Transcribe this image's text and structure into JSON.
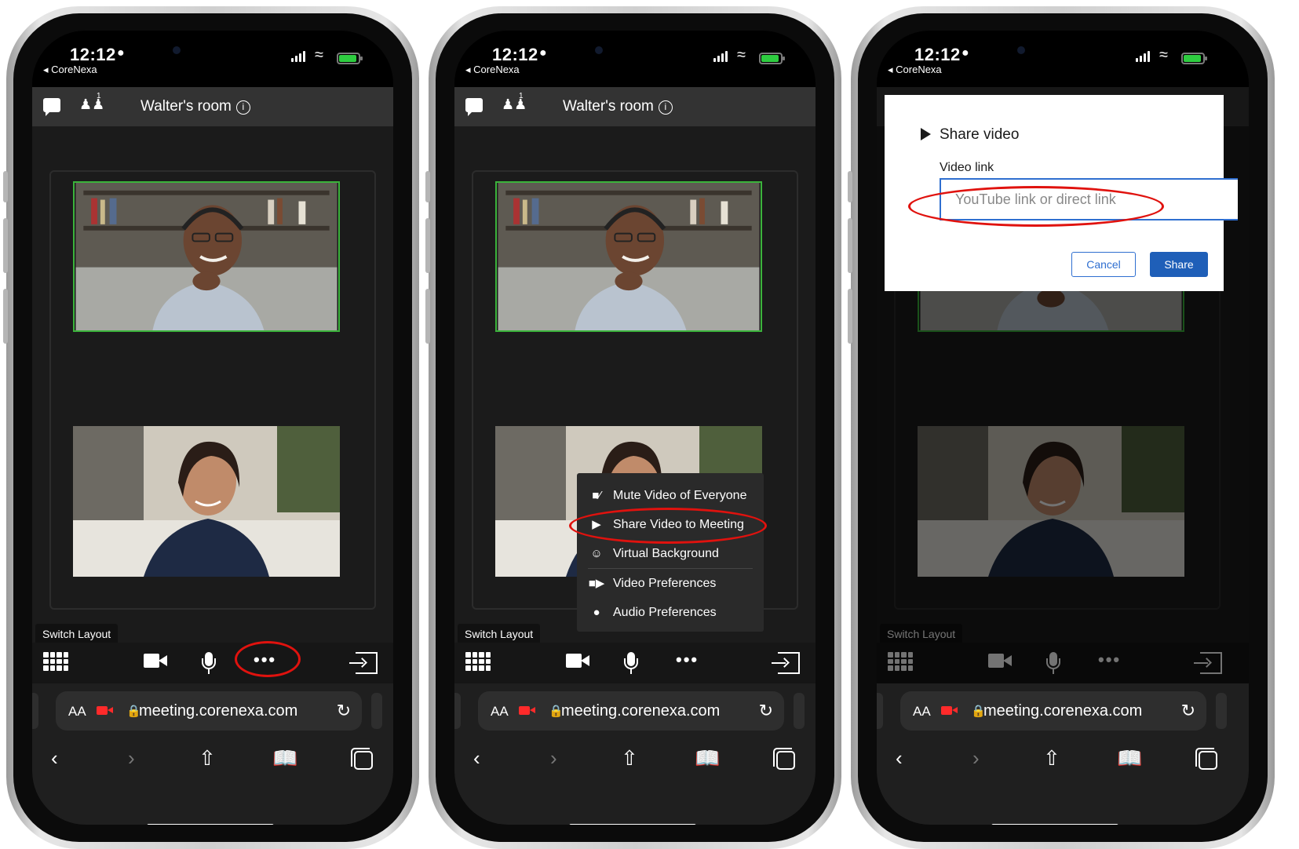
{
  "status": {
    "time": "12:12",
    "back_app": "◂ CoreNexa"
  },
  "room": {
    "title": "Walter's room",
    "participant_count": "1"
  },
  "switch_layout": "Switch Layout",
  "url": "meeting.corenexa.com",
  "text_size_label": "AA",
  "more_menu": {
    "items": [
      {
        "label": "Mute Video of Everyone",
        "icon": "video-off-icon"
      },
      {
        "label": "Share Video to Meeting",
        "icon": "play-icon"
      },
      {
        "label": "Virtual Background",
        "icon": "background-icon"
      },
      {
        "label": "Video Preferences",
        "icon": "camera-icon"
      },
      {
        "label": "Audio Preferences",
        "icon": "microphone-icon"
      }
    ]
  },
  "share_dialog": {
    "title": "Share video",
    "field_label": "Video link",
    "placeholder": "YouTube link or direct link",
    "cancel_label": "Cancel",
    "share_label": "Share"
  },
  "colors": {
    "accent": "#1f5fb8",
    "highlight_ring": "#e0120e",
    "active_speaker": "#3bb33b",
    "record": "#ff2a2a"
  }
}
